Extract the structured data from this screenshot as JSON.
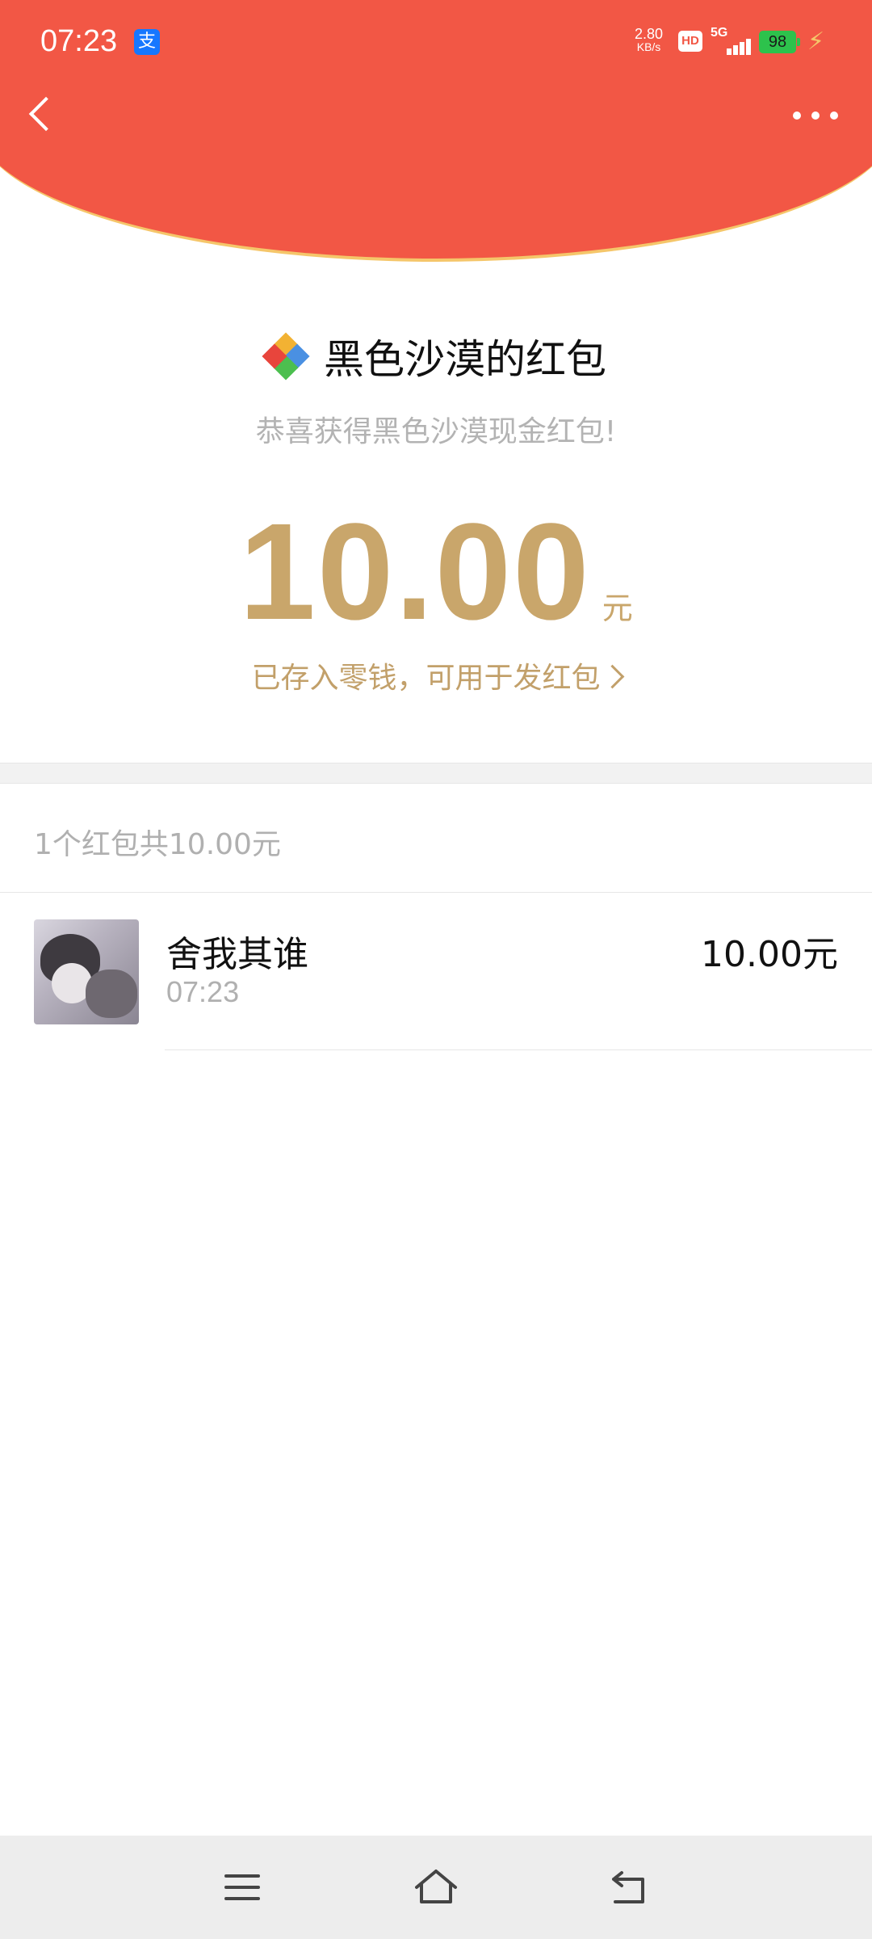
{
  "status_bar": {
    "time": "07:23",
    "app_badge": "支",
    "net_speed_value": "2.80",
    "net_speed_unit": "KB/s",
    "hd": "HD",
    "network": "5G",
    "battery": "98"
  },
  "colors": {
    "header_red": "#f25745",
    "gold": "#c9a66b",
    "header_border": "#f5c66a"
  },
  "nav": {
    "back_icon": "chevron-left-icon",
    "more_icon": "more-dots-icon"
  },
  "sender": {
    "name": "黑色沙漠的红包",
    "greeting": "恭喜获得黑色沙漠现金红包!"
  },
  "amount": {
    "value": "10.00",
    "unit": "元",
    "stored_text": "已存入零钱，可用于发红包"
  },
  "summary": "1个红包共10.00元",
  "recipients": [
    {
      "name": "舍我其谁",
      "time": "07:23",
      "amount": "10.00元"
    }
  ],
  "system_nav": [
    "menu-icon",
    "home-icon",
    "back-icon"
  ]
}
